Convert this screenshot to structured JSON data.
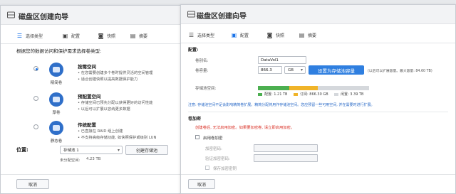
{
  "left_window": {
    "title": "磁盘区创建向导",
    "steps": [
      {
        "label": "选择类型",
        "icon": "list-icon"
      },
      {
        "label": "配置",
        "icon": "config-icon"
      },
      {
        "label": "快照",
        "icon": "snapshot-icon"
      },
      {
        "label": "摘要",
        "icon": "summary-icon"
      }
    ],
    "intro": "根据您的数据访问和保护需求选择卷类型:",
    "options": [
      {
        "label": "精简卷",
        "title": "按需空间",
        "lines": [
          "• 在您需要创建多个卷时提供灵活的空间管理",
          "• 适合创建快照以提高数据保护能力"
        ]
      },
      {
        "label": "厚卷",
        "title": "预配置空间",
        "lines": [
          "• 存储空间已预先分配以获得更好的访问性能",
          "• 以后可以扩展以容纳更多数据"
        ]
      },
      {
        "label": "静态卷",
        "title": "传统配置",
        "lines": [
          "• 已直接在 RAID 组上创建",
          "• 不支持高级存储功能, 如快照保护或级别 LUN"
        ]
      }
    ],
    "location_label": "位置:",
    "location_value": "存储池 1",
    "create_pool_button": "创建存储池",
    "unallocated_label": "未分配空间:",
    "unallocated_value": "4.23 TB",
    "cancel_button": "取消"
  },
  "right_window": {
    "title": "磁盘区创建向导",
    "steps": [
      {
        "label": "选择类型",
        "icon": "list-icon"
      },
      {
        "label": "配置",
        "icon": "config-icon"
      },
      {
        "label": "快照",
        "icon": "snapshot-icon"
      },
      {
        "label": "摘要",
        "icon": "summary-icon"
      }
    ],
    "config_section": "配置:",
    "volume_name_label": "卷别名:",
    "volume_name_value": "DataVol1",
    "capacity_label": "卷容量:",
    "capacity_value": "866.3",
    "capacity_unit": "GB",
    "max_button": "设置为存储池容量",
    "capacity_hint": "(以后可以扩展容量。最大容量: 84.60 TB)",
    "pool_space_label": "存储池空间:",
    "legend": [
      {
        "label": "配置:",
        "value": "1.21 TB",
        "color": "#4caf50"
      },
      {
        "label": "订阅:",
        "value": "866.30 GB",
        "color": "#f0b429"
      },
      {
        "label": "闲置:",
        "value": "3.39 TB",
        "color": "#d5d8dc"
      }
    ],
    "pool_note": "注意: 存储池空间不足会影响精简卷扩展。精简分配将用作存储池空间。您应预留一些可用空间, 并在需要时进行扩展。",
    "encryption_section": "卷加密",
    "encryption_warning": "创建卷后, 无法启用加密。如果要加密卷, 请立即启用加密。",
    "enable_encryption_label": "启用卷加密",
    "password_label": "加密密码:",
    "confirm_password_label": "验证加密密码:",
    "save_key_label": "保存加密密钥",
    "cancel_button": "取消"
  }
}
